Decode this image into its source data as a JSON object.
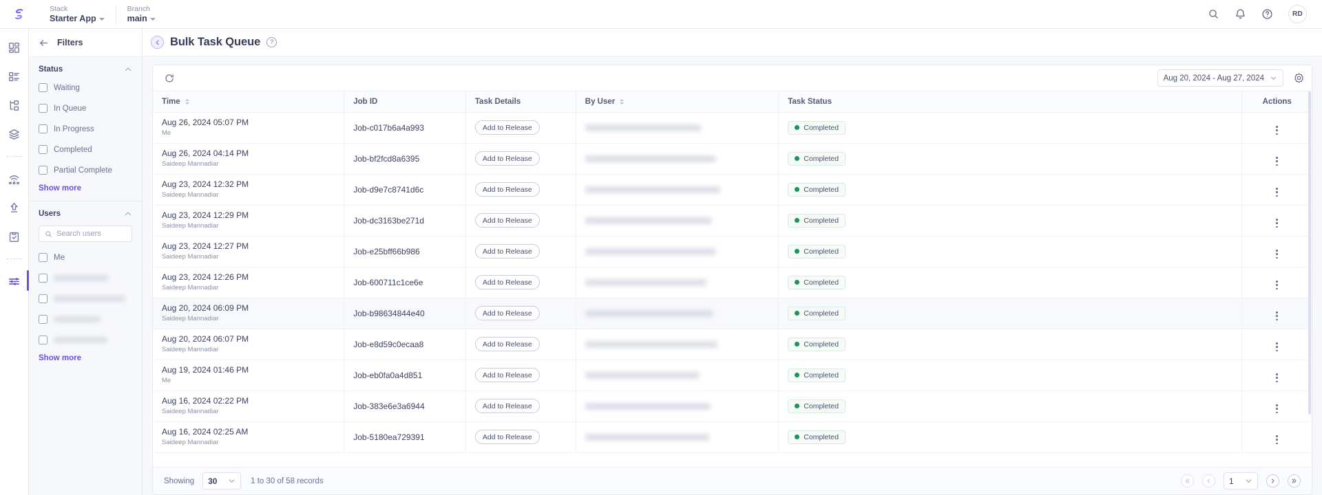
{
  "topbar": {
    "logo_icon": "brand-swirl-icon",
    "stack_label": "Stack",
    "stack_value": "Starter App",
    "branch_label": "Branch",
    "branch_value": "main",
    "search_icon": "search-icon",
    "notifications_icon": "bell-icon",
    "help_icon": "question-circle-icon",
    "avatar_initials": "RD"
  },
  "rail": {
    "items": [
      {
        "icon": "dashboard-grid-icon",
        "active": false
      },
      {
        "icon": "list-view-icon",
        "active": false
      },
      {
        "icon": "hierarchy-icon",
        "active": false
      },
      {
        "icon": "layers-icon",
        "active": false
      },
      {
        "icon": "deploy-antenna-icon",
        "active": false
      },
      {
        "icon": "upload-arrow-icon",
        "active": false
      },
      {
        "icon": "clipboard-check-icon",
        "active": false
      },
      {
        "icon": "sliders-filter-icon",
        "active": true
      }
    ]
  },
  "filters": {
    "back_icon": "arrow-left-icon",
    "title": "Filters",
    "status": {
      "title": "Status",
      "collapse_icon": "chevron-up-icon",
      "options": [
        {
          "label": "Waiting",
          "checked": false
        },
        {
          "label": "In Queue",
          "checked": false
        },
        {
          "label": "In Progress",
          "checked": false
        },
        {
          "label": "Completed",
          "checked": false
        },
        {
          "label": "Partial Complete",
          "checked": false
        }
      ],
      "show_more": "Show more"
    },
    "users": {
      "title": "Users",
      "collapse_icon": "chevron-up-icon",
      "search_placeholder": "Search users",
      "search_value": "",
      "search_icon": "search-icon",
      "options": [
        {
          "label": "Me",
          "checked": false,
          "redacted": false
        },
        {
          "label": "",
          "checked": false,
          "redacted": true
        },
        {
          "label": "",
          "checked": false,
          "redacted": true
        },
        {
          "label": "",
          "checked": false,
          "redacted": true
        },
        {
          "label": "",
          "checked": false,
          "redacted": true
        }
      ],
      "show_more": "Show more"
    }
  },
  "page": {
    "back_icon": "chevron-left-icon",
    "title": "Bulk Task Queue",
    "help_icon": "question-circle-icon"
  },
  "toolbar": {
    "refresh_icon": "refresh-icon",
    "date_range": "Aug 20, 2024 - Aug 27, 2024",
    "date_range_caret": "chevron-down-icon",
    "settings_icon": "gear-icon"
  },
  "table": {
    "columns": [
      {
        "label": "Time",
        "sortable": true
      },
      {
        "label": "Job ID",
        "sortable": false
      },
      {
        "label": "Task Details",
        "sortable": false
      },
      {
        "label": "By User",
        "sortable": true
      },
      {
        "label": "Task Status",
        "sortable": false
      },
      {
        "label": "Actions",
        "sortable": false
      }
    ],
    "action_button_label": "Add to Release",
    "row_menu_icon": "kebab-menu-icon",
    "rows": [
      {
        "time": "Aug 26, 2024 05:07 PM",
        "sub": "Me",
        "job_id": "Job-c017b6a4a993",
        "user_redacted": true,
        "status": "Completed",
        "highlight": false
      },
      {
        "time": "Aug 26, 2024 04:14 PM",
        "sub": "Saideep Mannadiar",
        "job_id": "Job-bf2fcd8a6395",
        "user_redacted": true,
        "status": "Completed",
        "highlight": false
      },
      {
        "time": "Aug 23, 2024 12:32 PM",
        "sub": "Saideep Mannadiar",
        "job_id": "Job-d9e7c8741d6c",
        "user_redacted": true,
        "status": "Completed",
        "highlight": false
      },
      {
        "time": "Aug 23, 2024 12:29 PM",
        "sub": "Saideep Mannadiar",
        "job_id": "Job-dc3163be271d",
        "user_redacted": true,
        "status": "Completed",
        "highlight": false
      },
      {
        "time": "Aug 23, 2024 12:27 PM",
        "sub": "Saideep Mannadiar",
        "job_id": "Job-e25bff66b986",
        "user_redacted": true,
        "status": "Completed",
        "highlight": false
      },
      {
        "time": "Aug 23, 2024 12:26 PM",
        "sub": "Saideep Mannadiar",
        "job_id": "Job-600711c1ce6e",
        "user_redacted": true,
        "status": "Completed",
        "highlight": false
      },
      {
        "time": "Aug 20, 2024 06:09 PM",
        "sub": "Saideep Mannadiar",
        "job_id": "Job-b98634844e40",
        "user_redacted": true,
        "status": "Completed",
        "highlight": true
      },
      {
        "time": "Aug 20, 2024 06:07 PM",
        "sub": "Saideep Mannadiar",
        "job_id": "Job-e8d59c0ecaa8",
        "user_redacted": true,
        "status": "Completed",
        "highlight": false
      },
      {
        "time": "Aug 19, 2024 01:46 PM",
        "sub": "Me",
        "job_id": "Job-eb0fa0a4d851",
        "user_redacted": true,
        "status": "Completed",
        "highlight": false
      },
      {
        "time": "Aug 16, 2024 02:22 PM",
        "sub": "Saideep Mannadiar",
        "job_id": "Job-383e6e3a6944",
        "user_redacted": true,
        "status": "Completed",
        "highlight": false
      },
      {
        "time": "Aug 16, 2024 02:25 AM",
        "sub": "Saideep Mannadiar",
        "job_id": "Job-5180ea729391",
        "user_redacted": true,
        "status": "Completed",
        "highlight": false
      }
    ]
  },
  "footer": {
    "showing_label": "Showing",
    "page_size": "30",
    "records_text": "1 to 30 of 58 records",
    "first_icon": "double-chevron-left-icon",
    "prev_icon": "chevron-left-icon",
    "current_page": "1",
    "next_icon": "chevron-right-icon",
    "last_icon": "double-chevron-right-icon"
  },
  "colors": {
    "accent": "#6c4ee3",
    "status_green": "#1f9254",
    "text": "#3d4260",
    "muted": "#8a90a8",
    "panel_bg": "#f7f8fc"
  }
}
